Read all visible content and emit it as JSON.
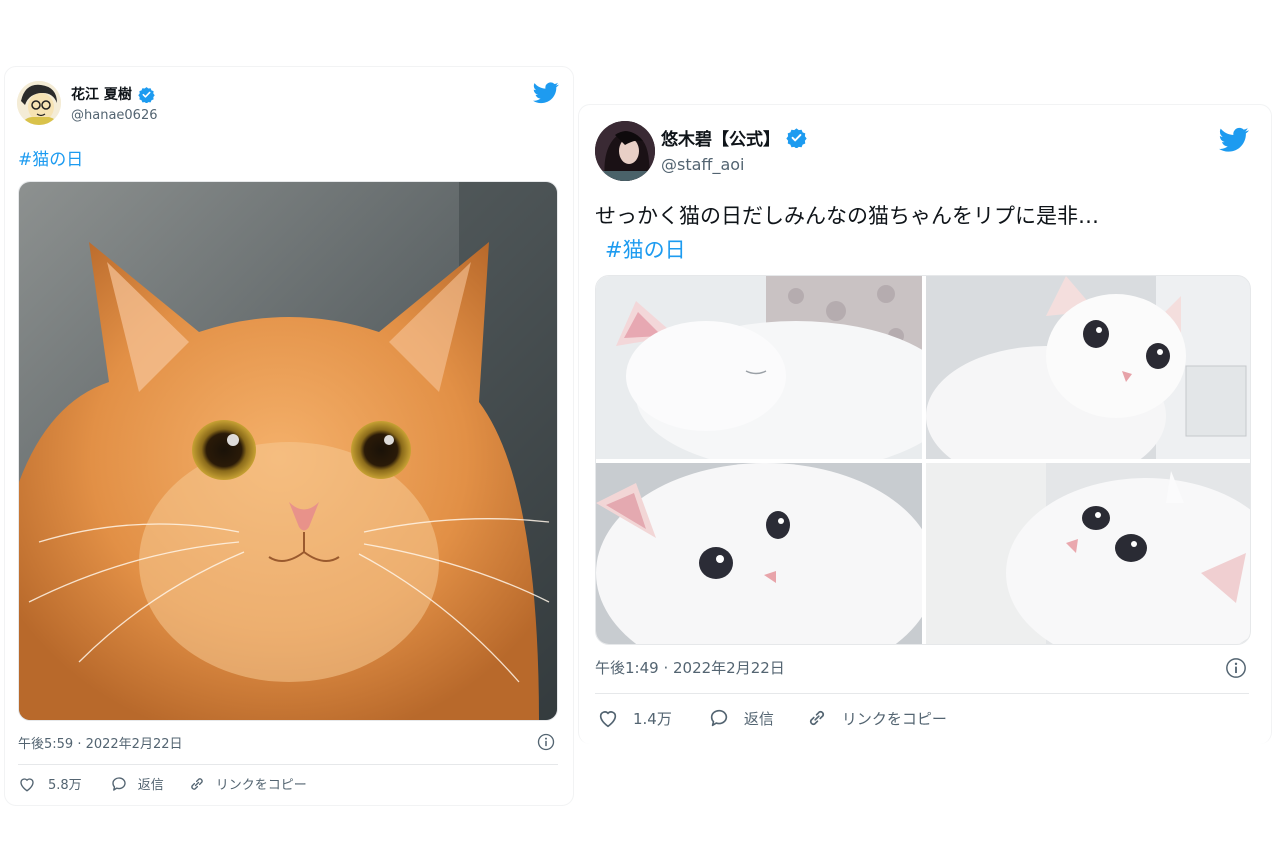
{
  "colors": {
    "link_blue": "#1d9bf0",
    "text_primary": "#0f1419",
    "text_secondary": "#536471",
    "verified_blue": "#1d9bf0"
  },
  "tweets": [
    {
      "display_name": "花江 夏樹",
      "handle": "@hanae0626",
      "verified": true,
      "body_text": "",
      "hashtag": "#猫の日",
      "media": {
        "type": "photo",
        "subject": "orange tabby cat close-up",
        "count": 1
      },
      "timestamp": "午後5:59 · 2022年2月22日",
      "likes": "5.8万",
      "reply_label": "返信",
      "copy_link_label": "リンクをコピー",
      "icons": [
        "twitter-bird-icon",
        "verified-badge-icon",
        "heart-icon",
        "reply-bubble-icon",
        "link-icon",
        "info-icon"
      ]
    },
    {
      "display_name": "悠木碧【公式】",
      "handle": "@staff_aoi",
      "verified": true,
      "body_text": "せっかく猫の日だしみんなの猫ちゃんをリプに是非…",
      "hashtag": "#猫の日",
      "media": {
        "type": "photo-grid",
        "subject": "white cat photos",
        "count": 4
      },
      "timestamp": "午後1:49 · 2022年2月22日",
      "likes": "1.4万",
      "reply_label": "返信",
      "copy_link_label": "リンクをコピー",
      "icons": [
        "twitter-bird-icon",
        "verified-badge-icon",
        "heart-icon",
        "reply-bubble-icon",
        "link-icon",
        "info-icon"
      ]
    }
  ]
}
